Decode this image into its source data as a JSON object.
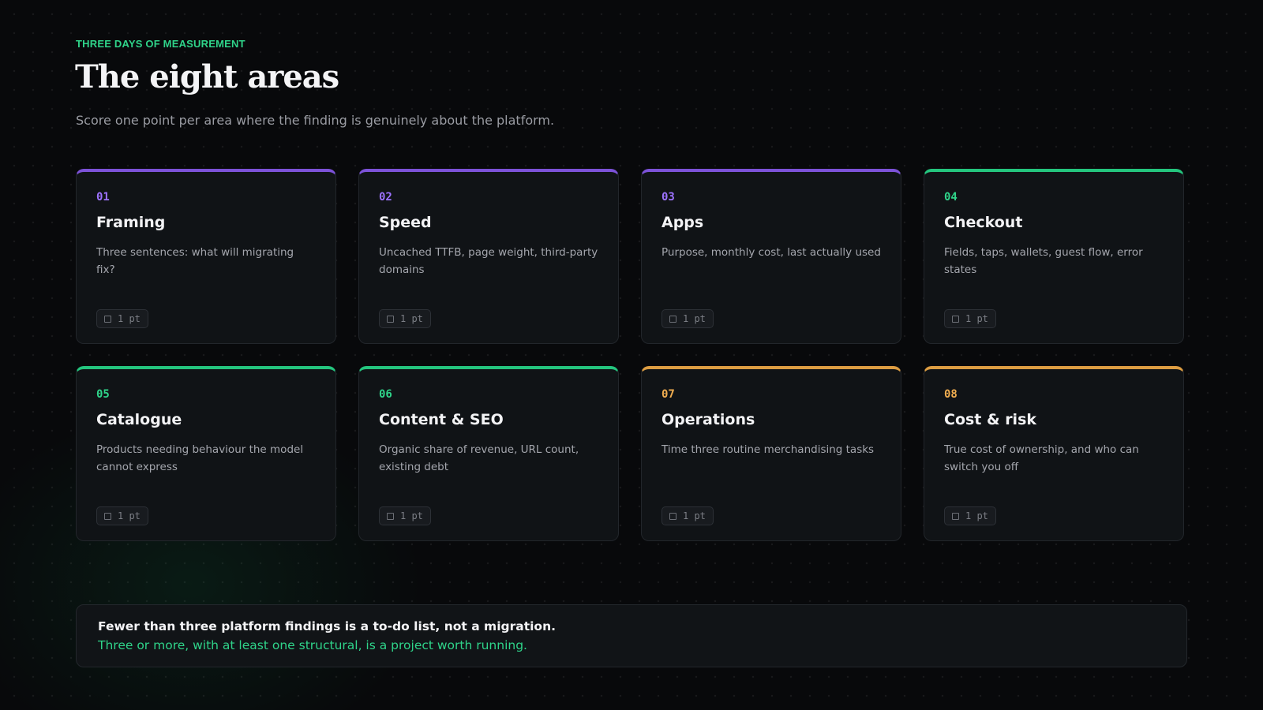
{
  "header": {
    "eyebrow": "THREE DAYS OF MEASUREMENT",
    "title": "The eight areas",
    "subtitle": "Score one point per area where the finding is genuinely about the platform."
  },
  "colors": {
    "purple": "#7c52d8",
    "green": "#24c57e",
    "amber": "#dd9d42",
    "background": "#08090b",
    "card": "#101316"
  },
  "cards": [
    {
      "number": "01",
      "title": "Framing",
      "description": "Three sentences: what will migrating fix?",
      "points": "1 pt",
      "accent": "purple"
    },
    {
      "number": "02",
      "title": "Speed",
      "description": "Uncached TTFB, page weight, third-party domains",
      "points": "1 pt",
      "accent": "purple"
    },
    {
      "number": "03",
      "title": "Apps",
      "description": "Purpose, monthly cost, last actually used",
      "points": "1 pt",
      "accent": "purple"
    },
    {
      "number": "04",
      "title": "Checkout",
      "description": "Fields, taps, wallets, guest flow, error states",
      "points": "1 pt",
      "accent": "green"
    },
    {
      "number": "05",
      "title": "Catalogue",
      "description": "Products needing behaviour the model cannot express",
      "points": "1 pt",
      "accent": "green"
    },
    {
      "number": "06",
      "title": "Content & SEO",
      "description": "Organic share of revenue, URL count, existing debt",
      "points": "1 pt",
      "accent": "green"
    },
    {
      "number": "07",
      "title": "Operations",
      "description": "Time three routine merchandising tasks",
      "points": "1 pt",
      "accent": "amber"
    },
    {
      "number": "08",
      "title": "Cost & risk",
      "description": "True cost of ownership, and who can switch you off",
      "points": "1 pt",
      "accent": "amber"
    }
  ],
  "callout": {
    "line1": "Fewer than three platform findings is a to-do list, not a migration.",
    "line2": "Three or more, with at least one structural, is a project worth running."
  },
  "icons": {
    "badge_icon": "checkbox-icon"
  }
}
